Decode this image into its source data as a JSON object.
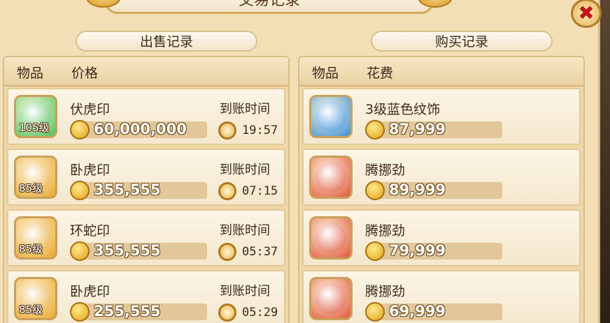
{
  "window": {
    "title": "交易记录"
  },
  "sell": {
    "title": "出售记录",
    "col_item": "物品",
    "col_price": "价格",
    "rows": [
      {
        "name": "伏虎印",
        "level": "105级",
        "price": "60,000,000",
        "arrive_label": "到账时间",
        "time": "19:57",
        "icon": "green-tiger-seal-icon",
        "color": "#4fc25a"
      },
      {
        "name": "卧虎印",
        "level": "85级",
        "price": "355,555",
        "arrive_label": "到账时间",
        "time": "07:15",
        "icon": "gold-tiger-seal-icon",
        "color": "#e8a62a"
      },
      {
        "name": "环蛇印",
        "level": "85级",
        "price": "355,555",
        "arrive_label": "到账时间",
        "time": "05:37",
        "icon": "gold-snake-seal-icon",
        "color": "#e8a62a"
      },
      {
        "name": "卧虎印",
        "level": "85级",
        "price": "255,555",
        "arrive_label": "到账时间",
        "time": "05:29",
        "icon": "gold-tiger-seal-icon",
        "color": "#e8a62a"
      }
    ]
  },
  "buy": {
    "title": "购买记录",
    "col_item": "物品",
    "col_cost": "花费",
    "rows": [
      {
        "name": "3级蓝色纹饰",
        "price": "87,999",
        "icon": "blue-ornament-icon",
        "color": "#3a8ed6"
      },
      {
        "name": "腾挪劲",
        "price": "89,999",
        "icon": "red-skill-book-icon",
        "color": "#e0553a"
      },
      {
        "name": "腾挪劲",
        "price": "79,999",
        "icon": "red-skill-book-icon",
        "color": "#e0553a"
      },
      {
        "name": "腾挪劲",
        "price": "69,999",
        "icon": "red-skill-book-icon",
        "color": "#e0553a"
      }
    ]
  }
}
